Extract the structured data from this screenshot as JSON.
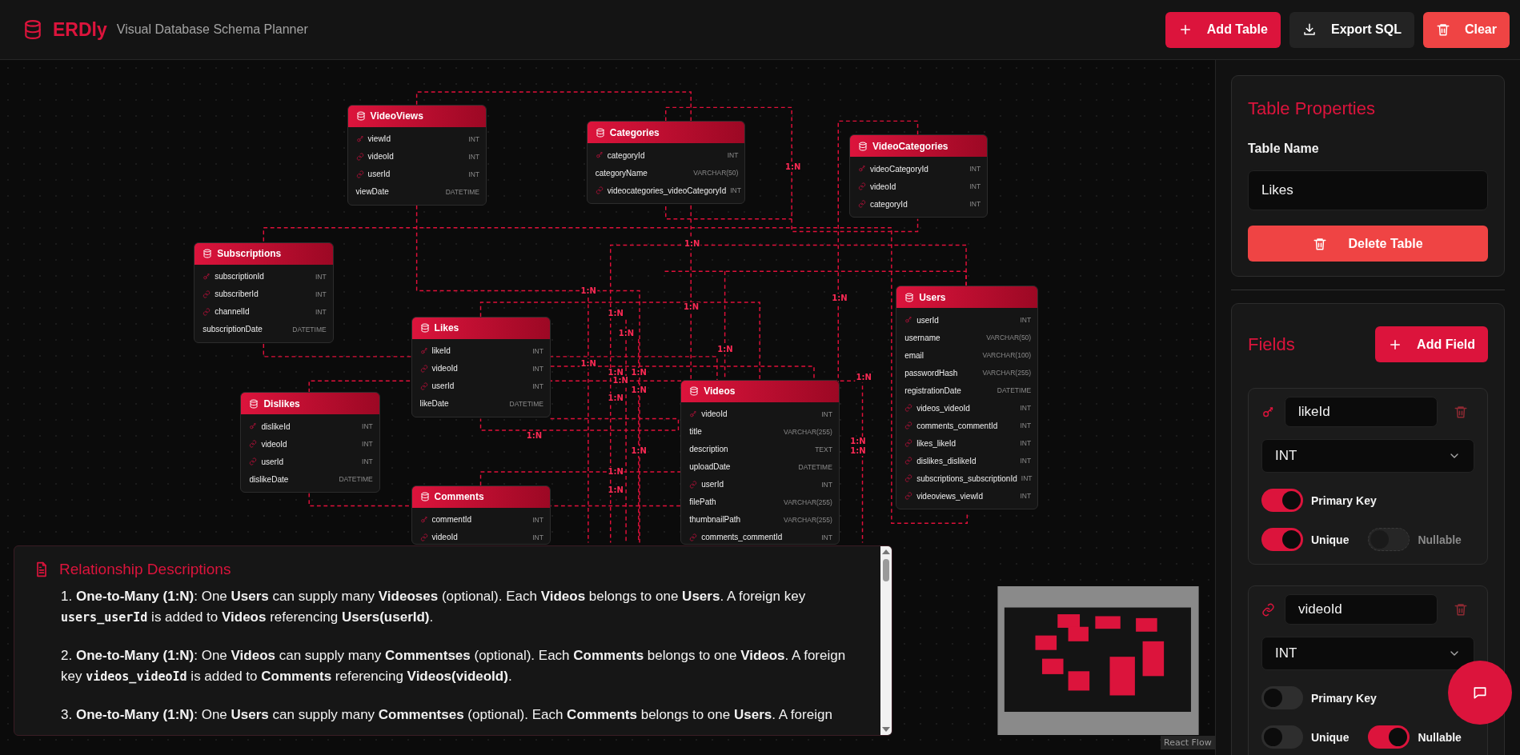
{
  "header": {
    "logo": "ERDly",
    "subtitle": "Visual Database Schema Planner",
    "buttons": [
      {
        "kind": "add",
        "label": "Add Table"
      },
      {
        "kind": "export",
        "label": "Export SQL"
      },
      {
        "kind": "clear",
        "label": "Clear"
      }
    ]
  },
  "tables": [
    {
      "name": "VideoViews",
      "fields": [
        {
          "name": "viewId",
          "type": "INT",
          "kind": "primary"
        },
        {
          "name": "videoId",
          "type": "INT",
          "kind": "foreign"
        },
        {
          "name": "userId",
          "type": "INT",
          "kind": "foreign"
        },
        {
          "name": "viewDate",
          "type": "DATETIME",
          "kind": "plain"
        }
      ]
    },
    {
      "name": "Categories",
      "fields": [
        {
          "name": "categoryId",
          "type": "INT",
          "kind": "primary"
        },
        {
          "name": "categoryName",
          "type": "VARCHAR(50)",
          "kind": "plain"
        },
        {
          "name": "videocategories_videoCategoryId",
          "type": "INT",
          "kind": "foreign"
        }
      ]
    },
    {
      "name": "VideoCategories",
      "fields": [
        {
          "name": "videoCategoryId",
          "type": "INT",
          "kind": "primary"
        },
        {
          "name": "videoId",
          "type": "INT",
          "kind": "foreign"
        },
        {
          "name": "categoryId",
          "type": "INT",
          "kind": "foreign"
        }
      ]
    },
    {
      "name": "Subscriptions",
      "fields": [
        {
          "name": "subscriptionId",
          "type": "INT",
          "kind": "primary"
        },
        {
          "name": "subscriberId",
          "type": "INT",
          "kind": "foreign"
        },
        {
          "name": "channelId",
          "type": "INT",
          "kind": "foreign"
        },
        {
          "name": "subscriptionDate",
          "type": "DATETIME",
          "kind": "plain"
        }
      ]
    },
    {
      "name": "Users",
      "fields": [
        {
          "name": "userId",
          "type": "INT",
          "kind": "primary"
        },
        {
          "name": "username",
          "type": "VARCHAR(50)",
          "kind": "plain"
        },
        {
          "name": "email",
          "type": "VARCHAR(100)",
          "kind": "plain"
        },
        {
          "name": "passwordHash",
          "type": "VARCHAR(255)",
          "kind": "plain"
        },
        {
          "name": "registrationDate",
          "type": "DATETIME",
          "kind": "plain"
        },
        {
          "name": "videos_videoId",
          "type": "INT",
          "kind": "foreign"
        },
        {
          "name": "comments_commentId",
          "type": "INT",
          "kind": "foreign"
        },
        {
          "name": "likes_likeId",
          "type": "INT",
          "kind": "foreign"
        },
        {
          "name": "dislikes_dislikeId",
          "type": "INT",
          "kind": "foreign"
        },
        {
          "name": "subscriptions_subscriptionId",
          "type": "INT",
          "kind": "foreign"
        },
        {
          "name": "videoviews_viewId",
          "type": "INT",
          "kind": "foreign"
        }
      ]
    },
    {
      "name": "Likes",
      "fields": [
        {
          "name": "likeId",
          "type": "INT",
          "kind": "primary"
        },
        {
          "name": "videoId",
          "type": "INT",
          "kind": "foreign"
        },
        {
          "name": "userId",
          "type": "INT",
          "kind": "foreign"
        },
        {
          "name": "likeDate",
          "type": "DATETIME",
          "kind": "plain"
        }
      ]
    },
    {
      "name": "Dislikes",
      "fields": [
        {
          "name": "dislikeId",
          "type": "INT",
          "kind": "primary"
        },
        {
          "name": "videoId",
          "type": "INT",
          "kind": "foreign"
        },
        {
          "name": "userId",
          "type": "INT",
          "kind": "foreign"
        },
        {
          "name": "dislikeDate",
          "type": "DATETIME",
          "kind": "plain"
        }
      ]
    },
    {
      "name": "Comments",
      "fields": [
        {
          "name": "commentId",
          "type": "INT",
          "kind": "primary"
        },
        {
          "name": "videoId",
          "type": "INT",
          "kind": "foreign"
        }
      ]
    },
    {
      "name": "Videos",
      "fields": [
        {
          "name": "videoId",
          "type": "INT",
          "kind": "primary"
        },
        {
          "name": "title",
          "type": "VARCHAR(255)",
          "kind": "plain"
        },
        {
          "name": "description",
          "type": "TEXT",
          "kind": "plain"
        },
        {
          "name": "uploadDate",
          "type": "DATETIME",
          "kind": "plain"
        },
        {
          "name": "userId",
          "type": "INT",
          "kind": "foreign"
        },
        {
          "name": "filePath",
          "type": "VARCHAR(255)",
          "kind": "plain"
        },
        {
          "name": "thumbnailPath",
          "type": "VARCHAR(255)",
          "kind": "plain"
        },
        {
          "name": "comments_commentId",
          "type": "INT",
          "kind": "foreign"
        }
      ]
    }
  ],
  "relationship_labels": [
    "1:N",
    "1:N",
    "1:N",
    "1:N",
    "1:N",
    "1:N",
    "1:N",
    "1:N",
    "1:N",
    "1:N",
    "1:N",
    "1:N",
    "1:N",
    "1:N",
    "1:N",
    "1:N",
    "1:N",
    "1:N",
    "1:N",
    "1:N",
    "1:N"
  ],
  "descriptions": {
    "title": "Relationship Descriptions",
    "items": [
      [
        {
          "kind": "text",
          "text": "1. "
        },
        {
          "kind": "bold",
          "text": "One-to-Many (1:N)"
        },
        {
          "kind": "text",
          "text": ": One "
        },
        {
          "kind": "bold",
          "text": "Users"
        },
        {
          "kind": "text",
          "text": " can supply many "
        },
        {
          "kind": "bold",
          "text": "Videoses"
        },
        {
          "kind": "text",
          "text": " (optional). Each "
        },
        {
          "kind": "bold",
          "text": "Videos"
        },
        {
          "kind": "text",
          "text": " belongs to one "
        },
        {
          "kind": "bold",
          "text": "Users"
        },
        {
          "kind": "text",
          "text": ". A foreign key "
        },
        {
          "kind": "code",
          "text": "users_userId"
        },
        {
          "kind": "text",
          "text": " is added to "
        },
        {
          "kind": "bold",
          "text": "Videos"
        },
        {
          "kind": "text",
          "text": " referencing "
        },
        {
          "kind": "bold",
          "text": "Users(userId)"
        },
        {
          "kind": "text",
          "text": "."
        }
      ],
      [
        {
          "kind": "text",
          "text": "2. "
        },
        {
          "kind": "bold",
          "text": "One-to-Many (1:N)"
        },
        {
          "kind": "text",
          "text": ": One "
        },
        {
          "kind": "bold",
          "text": "Videos"
        },
        {
          "kind": "text",
          "text": " can supply many "
        },
        {
          "kind": "bold",
          "text": "Commentses"
        },
        {
          "kind": "text",
          "text": " (optional). Each "
        },
        {
          "kind": "bold",
          "text": "Comments"
        },
        {
          "kind": "text",
          "text": " belongs to one "
        },
        {
          "kind": "bold",
          "text": "Videos"
        },
        {
          "kind": "text",
          "text": ". A foreign key "
        },
        {
          "kind": "code",
          "text": "videos_videoId"
        },
        {
          "kind": "text",
          "text": " is added to "
        },
        {
          "kind": "bold",
          "text": "Comments"
        },
        {
          "kind": "text",
          "text": " referencing "
        },
        {
          "kind": "bold",
          "text": "Videos(videoId)"
        },
        {
          "kind": "text",
          "text": "."
        }
      ],
      [
        {
          "kind": "text",
          "text": "3. "
        },
        {
          "kind": "bold",
          "text": "One-to-Many (1:N)"
        },
        {
          "kind": "text",
          "text": ": One "
        },
        {
          "kind": "bold",
          "text": "Users"
        },
        {
          "kind": "text",
          "text": " can supply many "
        },
        {
          "kind": "bold",
          "text": "Commentses"
        },
        {
          "kind": "text",
          "text": " (optional). Each "
        },
        {
          "kind": "bold",
          "text": "Comments"
        },
        {
          "kind": "text",
          "text": " belongs to one "
        },
        {
          "kind": "bold",
          "text": "Users"
        },
        {
          "kind": "text",
          "text": ". A foreign"
        }
      ]
    ]
  },
  "attribution": "React Flow",
  "properties": {
    "title": "Table Properties",
    "name_label": "Table Name",
    "name_value": "Likes",
    "delete_button": "Delete Table"
  },
  "fields_panel": {
    "title": "Fields",
    "add_button": "Add Field",
    "fields": [
      {
        "kind": "primary",
        "name": "likeId",
        "type": "INT",
        "toggles": [
          {
            "label": "Primary Key",
            "on": true,
            "disabled": false
          },
          {
            "label": "Unique",
            "on": true,
            "disabled": false
          },
          {
            "label": "Nullable",
            "on": false,
            "disabled": true
          }
        ]
      },
      {
        "kind": "foreign",
        "name": "videoId",
        "type": "INT",
        "toggles": [
          {
            "label": "Primary Key",
            "on": false,
            "disabled": false
          },
          {
            "label": "Unique",
            "on": false,
            "disabled": false
          },
          {
            "label": "Nullable",
            "on": true,
            "disabled": false
          }
        ]
      }
    ]
  }
}
